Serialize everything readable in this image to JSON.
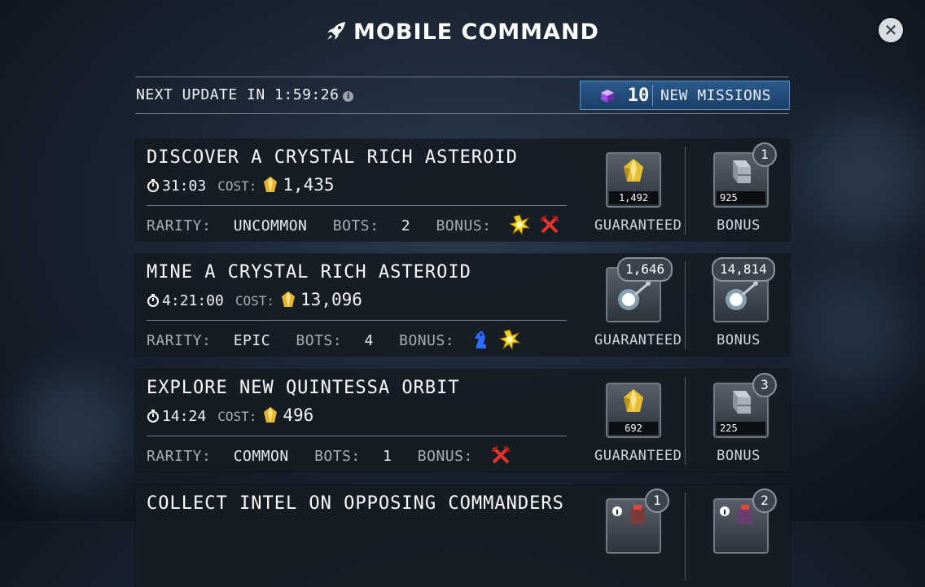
{
  "header": {
    "title": "MOBILE COMMAND",
    "icon": "rocket-icon"
  },
  "close": {
    "label": "✕",
    "icon": "close-icon"
  },
  "status": {
    "next_update": "NEXT UPDATE IN 1:59:26",
    "info_icon": "i"
  },
  "new_missions": {
    "count": "10",
    "label": "NEW MISSIONS",
    "icon": "cube-icon"
  },
  "labels": {
    "cost": "COST:",
    "rarity": "RARITY:",
    "bots": "BOTS:",
    "bonus": "BONUS:",
    "guaranteed": "GUARANTEED",
    "bonus_reward": "BONUS"
  },
  "missions": [
    {
      "title": "DISCOVER A CRYSTAL RICH ASTEROID",
      "time": "31:03",
      "cost": "1,435",
      "rarity": "UNCOMMON",
      "bots": "2",
      "bonus_icons": [
        "explosion-icon",
        "crossed-swords-icon"
      ],
      "guaranteed": {
        "item": "energon-crystal",
        "qty": "1,492"
      },
      "bonus": {
        "item": "metal-alloy",
        "qty": "925",
        "badge": "1"
      }
    },
    {
      "title": "MINE A CRYSTAL RICH ASTEROID",
      "time": "4:21:00",
      "cost": "13,096",
      "rarity": "EPIC",
      "bots": "4",
      "bonus_icons": [
        "knight-icon",
        "explosion-icon"
      ],
      "guaranteed": {
        "item": "energy-orb",
        "badge": "1,646"
      },
      "bonus": {
        "item": "energy-orb",
        "badge": "14,814"
      }
    },
    {
      "title": "EXPLORE NEW QUINTESSA ORBIT",
      "time": "14:24",
      "cost": "496",
      "rarity": "COMMON",
      "bots": "1",
      "bonus_icons": [
        "crossed-swords-icon"
      ],
      "guaranteed": {
        "item": "energon-crystal",
        "qty": "692"
      },
      "bonus": {
        "item": "metal-alloy",
        "qty": "225",
        "badge": "3"
      }
    },
    {
      "title": "COLLECT INTEL ON OPPOSING COMMANDERS",
      "guaranteed": {
        "item": "bot-card",
        "badge": "1"
      },
      "bonus": {
        "item": "bot-card",
        "badge": "2"
      }
    }
  ]
}
